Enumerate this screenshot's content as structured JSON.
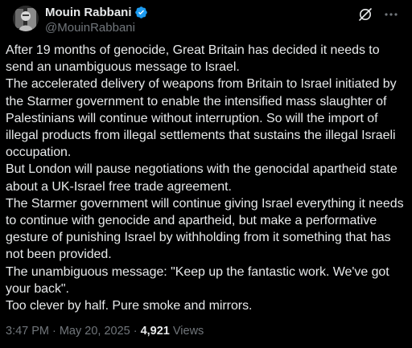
{
  "author": {
    "display_name": "Mouin Rabbani",
    "handle": "@MouinRabbani",
    "verified": true,
    "verified_color": "#1d9bf0"
  },
  "header_icons": {
    "grok": "grok-icon",
    "more": "more-icon"
  },
  "tweet": {
    "paragraphs": [
      "After 19 months of genocide, Great Britain has decided it needs to send an unambiguous message to Israel.",
      "The accelerated delivery of weapons from Britain to Israel initiated by the Starmer government to enable the intensified mass slaughter of Palestinians will continue without interruption. So will the import of illegal products from illegal settlements that sustains the illegal Israeli occupation.",
      "But London will pause negotiations with the genocidal apartheid state about a UK-Israel free trade agreement.",
      "The Starmer government will continue giving Israel everything it needs to continue with genocide and apartheid, but make a performative gesture of punishing Israel by withholding from it something that has not been provided.",
      "The unambiguous message: \"Keep up the fantastic work. We've got your back\".",
      "Too clever by half. Pure smoke and mirrors."
    ]
  },
  "meta": {
    "time": "3:47 PM",
    "separator": "·",
    "date": "May 20, 2025",
    "views_count": "4,921",
    "views_label": "Views"
  },
  "colors": {
    "background": "#000000",
    "text": "#e7e9ea",
    "secondary": "#71767b",
    "accent": "#1d9bf0"
  }
}
